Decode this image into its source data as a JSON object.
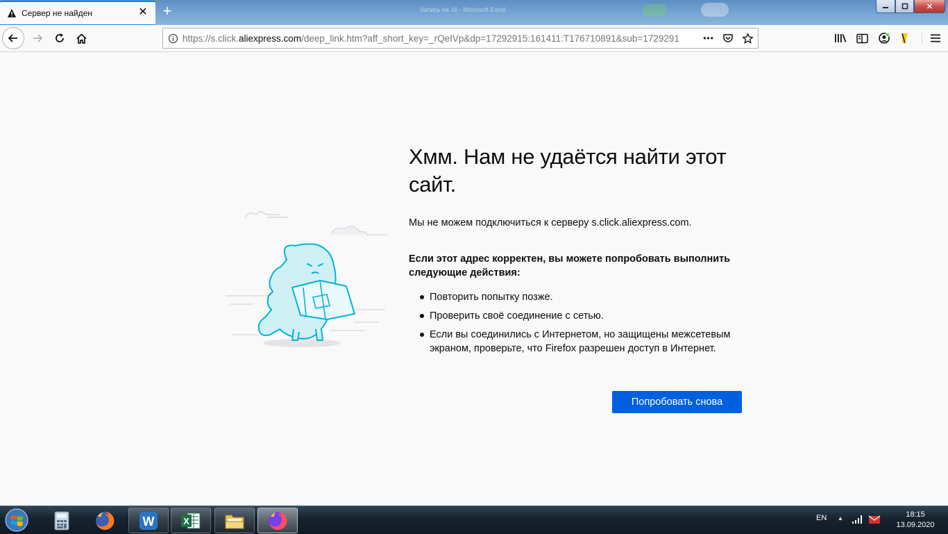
{
  "tab": {
    "title": "Сервер не найден"
  },
  "titlebar": {
    "hint": "Запись на 16 - Microsoft Excel"
  },
  "urlbar": {
    "url_prefix": "https://s.click.",
    "url_domain": "aliexpress.com",
    "url_rest": "/deep_link.htm?aff_short_key=_rQeIVp&dp=17292915:161411:T176710891&sub=1729291",
    "more": "•••"
  },
  "error": {
    "title": "Хмм. Нам не удаётся найти этот сайт.",
    "description": "Мы не можем подключиться к серверу s.click.aliexpress.com.",
    "suggestion_heading": "Если этот адрес корректен, вы можете попробовать выполнить следующие действия:",
    "suggestions": [
      "Повторить попытку позже.",
      "Проверить своё соединение с сетью.",
      "Если вы соединились с Интернетом, но защищены межсетевым экраном, проверьте, что Firefox разрешен доступ в Интернет."
    ],
    "retry_label": "Попробовать снова"
  },
  "taskbar": {
    "language": "EN",
    "time": "18:15",
    "date": "13.09.2020",
    "apps": [
      "calculator",
      "firefox",
      "wps-writer",
      "excel",
      "file-explorer",
      "firefox-active"
    ]
  },
  "colors": {
    "accent": "#0060df",
    "tab_highlight": "#0a84ff",
    "page_background": "#f9f9fa",
    "illustration": "#00c8d7"
  }
}
